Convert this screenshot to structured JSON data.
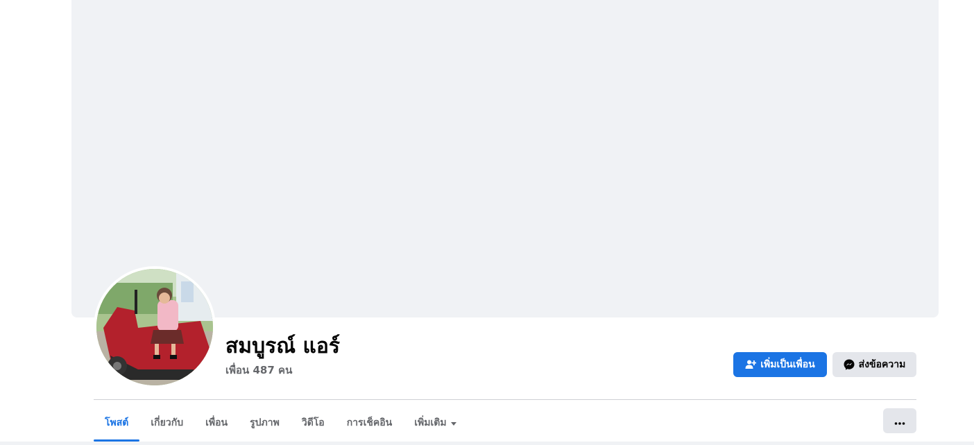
{
  "profile": {
    "name": "สมบูรณ์ แอร์",
    "friends_text": "เพื่อน 487 คน"
  },
  "actions": {
    "add_friend_label": "เพิ่มเป็นเพื่อน",
    "message_label": "ส่งข้อความ",
    "add_friend_icon": "add-person-icon",
    "message_icon": "messenger-icon"
  },
  "tabs": [
    {
      "label": "โพสต์",
      "active": true
    },
    {
      "label": "เกี่ยวกับ"
    },
    {
      "label": "เพื่อน"
    },
    {
      "label": "รูปภาพ"
    },
    {
      "label": "วิดีโอ"
    },
    {
      "label": "การเช็คอิน"
    },
    {
      "label": "เพิ่มเติม"
    }
  ],
  "colors": {
    "primary": "#1b74e4",
    "secondary_button": "#e4e6eb",
    "cover": "#f0f2f5",
    "muted_text": "#65676b"
  }
}
